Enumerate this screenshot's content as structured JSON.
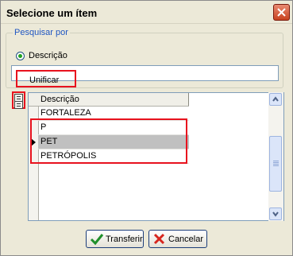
{
  "dialog": {
    "title": "Selecione um ítem",
    "close_icon": "close-x-icon"
  },
  "search": {
    "group_label": "Pesquisar por",
    "option_label": "Descrição",
    "option_selected": true,
    "value": "Unificar"
  },
  "grid": {
    "column_header": "Descrição",
    "rows": [
      {
        "text": "FORTALEZA",
        "selected": false
      },
      {
        "text": "P",
        "selected": false
      },
      {
        "text": "PET",
        "selected": true
      },
      {
        "text": "PETRÓPOLIS",
        "selected": false
      }
    ]
  },
  "buttons": {
    "transfer_label": "Transferir",
    "transfer_icon": "check-icon",
    "cancel_label": "Cancelar",
    "cancel_icon": "cross-icon"
  },
  "colors": {
    "highlight": "#e8121e",
    "group_label": "#1f56c2",
    "selected_row": "#c0c0c0"
  }
}
